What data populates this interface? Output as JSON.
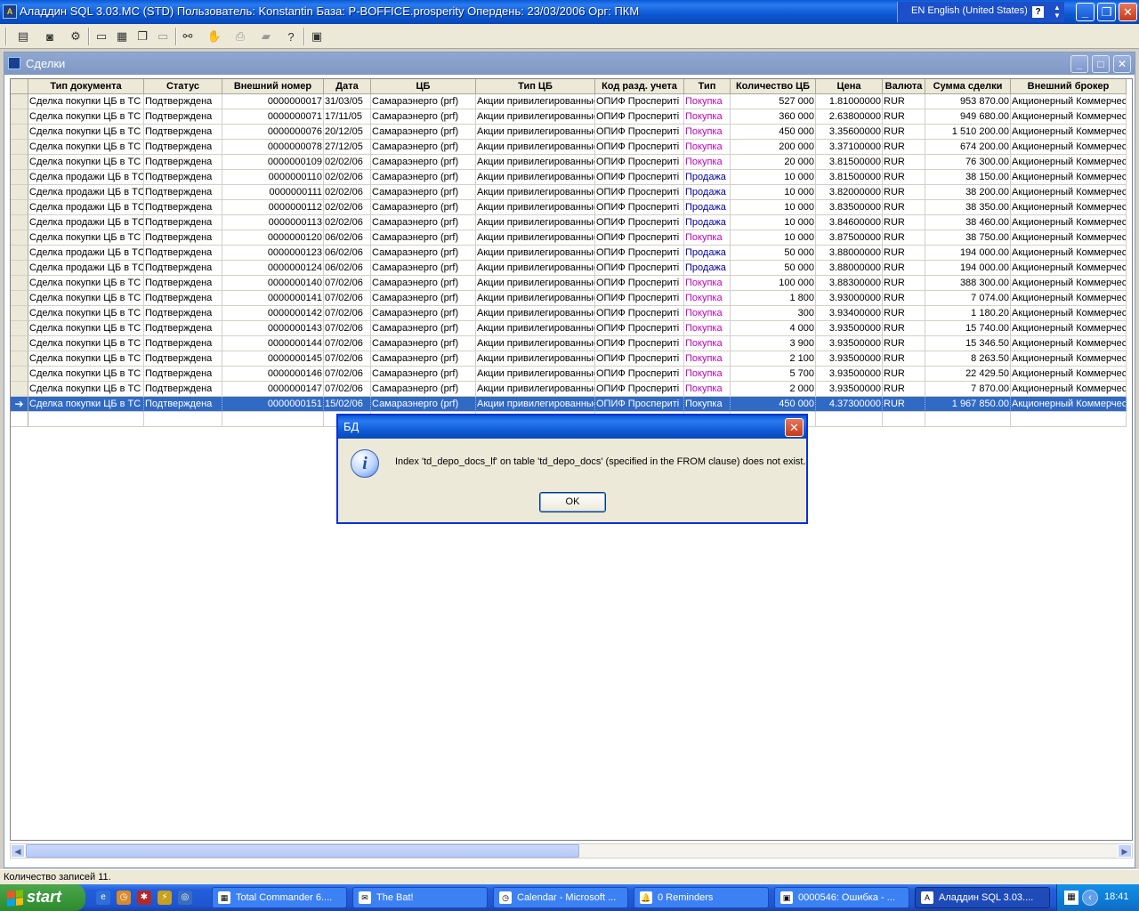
{
  "app": {
    "title": "Аладдин SQL 3.03.MC (STD)  Пользователь: Konstantin База: P-BOFFICE.prosperity Опердень: 23/03/2006 Орг: ПКМ",
    "language": "EN English (United States)",
    "help_label": "?"
  },
  "toolbar": {
    "icons": [
      "list-icon",
      "database-icon",
      "tools-icon",
      "window-icon",
      "tile-icon",
      "cascade-icon",
      "window-disabled-icon",
      "binoculars-icon",
      "hand-disabled-icon",
      "print-icon",
      "export-icon",
      "help-icon",
      "exit-icon"
    ]
  },
  "window": {
    "title": "Сделки"
  },
  "grid": {
    "columns": [
      "Тип документа",
      "Статус",
      "Внешний номер",
      "Дата",
      "ЦБ",
      "Тип ЦБ",
      "Код разд. учета",
      "Тип",
      "Количество ЦБ",
      "Цена",
      "Валюта",
      "Сумма сделки",
      "Внешний брокер"
    ],
    "rows": [
      [
        "Сделка покупки ЦБ в ТС",
        "Подтверждена",
        "0000000017",
        "31/03/05",
        "Самараэнерго (prf)",
        "Акции привилегированные",
        "ОПИФ Проспериті",
        "Покупка",
        "527 000",
        "1.81000000",
        "RUR",
        "953 870.00",
        "Акционерный Коммерческ"
      ],
      [
        "Сделка покупки ЦБ в ТС",
        "Подтверждена",
        "0000000071",
        "17/11/05",
        "Самараэнерго (prf)",
        "Акции привилегированные",
        "ОПИФ Проспериті",
        "Покупка",
        "360 000",
        "2.63800000",
        "RUR",
        "949 680.00",
        "Акционерный Коммерческ"
      ],
      [
        "Сделка покупки ЦБ в ТС",
        "Подтверждена",
        "0000000076",
        "20/12/05",
        "Самараэнерго (prf)",
        "Акции привилегированные",
        "ОПИФ Проспериті",
        "Покупка",
        "450 000",
        "3.35600000",
        "RUR",
        "1 510 200.00",
        "Акционерный Коммерческ"
      ],
      [
        "Сделка покупки ЦБ в ТС",
        "Подтверждена",
        "0000000078",
        "27/12/05",
        "Самараэнерго (prf)",
        "Акции привилегированные",
        "ОПИФ Проспериті",
        "Покупка",
        "200 000",
        "3.37100000",
        "RUR",
        "674 200.00",
        "Акционерный Коммерческ"
      ],
      [
        "Сделка покупки ЦБ в ТС",
        "Подтверждена",
        "0000000109",
        "02/02/06",
        "Самараэнерго (prf)",
        "Акции привилегированные",
        "ОПИФ Проспериті",
        "Покупка",
        "20 000",
        "3.81500000",
        "RUR",
        "76 300.00",
        "Акционерный Коммерческ"
      ],
      [
        "Сделка продажи ЦБ в ТС",
        "Подтверждена",
        "0000000110",
        "02/02/06",
        "Самараэнерго (prf)",
        "Акции привилегированные",
        "ОПИФ Проспериті",
        "Продажа",
        "10 000",
        "3.81500000",
        "RUR",
        "38 150.00",
        "Акционерный Коммерческ"
      ],
      [
        "Сделка продажи ЦБ в ТС",
        "Подтверждена",
        "0000000111",
        "02/02/06",
        "Самараэнерго (prf)",
        "Акции привилегированные",
        "ОПИФ Проспериті",
        "Продажа",
        "10 000",
        "3.82000000",
        "RUR",
        "38 200.00",
        "Акционерный Коммерческ"
      ],
      [
        "Сделка продажи ЦБ в ТС",
        "Подтверждена",
        "0000000112",
        "02/02/06",
        "Самараэнерго (prf)",
        "Акции привилегированные",
        "ОПИФ Проспериті",
        "Продажа",
        "10 000",
        "3.83500000",
        "RUR",
        "38 350.00",
        "Акционерный Коммерческ"
      ],
      [
        "Сделка продажи ЦБ в ТС",
        "Подтверждена",
        "0000000113",
        "02/02/06",
        "Самараэнерго (prf)",
        "Акции привилегированные",
        "ОПИФ Проспериті",
        "Продажа",
        "10 000",
        "3.84600000",
        "RUR",
        "38 460.00",
        "Акционерный Коммерческ"
      ],
      [
        "Сделка покупки ЦБ в ТС",
        "Подтверждена",
        "0000000120",
        "06/02/06",
        "Самараэнерго (prf)",
        "Акции привилегированные",
        "ОПИФ Проспериті",
        "Покупка",
        "10 000",
        "3.87500000",
        "RUR",
        "38 750.00",
        "Акционерный Коммерческ"
      ],
      [
        "Сделка продажи ЦБ в ТС",
        "Подтверждена",
        "0000000123",
        "06/02/06",
        "Самараэнерго (prf)",
        "Акции привилегированные",
        "ОПИФ Проспериті",
        "Продажа",
        "50 000",
        "3.88000000",
        "RUR",
        "194 000.00",
        "Акционерный Коммерческ"
      ],
      [
        "Сделка продажи ЦБ в ТС",
        "Подтверждена",
        "0000000124",
        "06/02/06",
        "Самараэнерго (prf)",
        "Акции привилегированные",
        "ОПИФ Проспериті",
        "Продажа",
        "50 000",
        "3.88000000",
        "RUR",
        "194 000.00",
        "Акционерный Коммерческ"
      ],
      [
        "Сделка покупки ЦБ в ТС",
        "Подтверждена",
        "0000000140",
        "07/02/06",
        "Самараэнерго (prf)",
        "Акции привилегированные",
        "ОПИФ Проспериті",
        "Покупка",
        "100 000",
        "3.88300000",
        "RUR",
        "388 300.00",
        "Акционерный Коммерческ"
      ],
      [
        "Сделка покупки ЦБ в ТС",
        "Подтверждена",
        "0000000141",
        "07/02/06",
        "Самараэнерго (prf)",
        "Акции привилегированные",
        "ОПИФ Проспериті",
        "Покупка",
        "1 800",
        "3.93000000",
        "RUR",
        "7 074.00",
        "Акционерный Коммерческ"
      ],
      [
        "Сделка покупки ЦБ в ТС",
        "Подтверждена",
        "0000000142",
        "07/02/06",
        "Самараэнерго (prf)",
        "Акции привилегированные",
        "ОПИФ Проспериті",
        "Покупка",
        "300",
        "3.93400000",
        "RUR",
        "1 180.20",
        "Акционерный Коммерческ"
      ],
      [
        "Сделка покупки ЦБ в ТС",
        "Подтверждена",
        "0000000143",
        "07/02/06",
        "Самараэнерго (prf)",
        "Акции привилегированные",
        "ОПИФ Проспериті",
        "Покупка",
        "4 000",
        "3.93500000",
        "RUR",
        "15 740.00",
        "Акционерный Коммерческ"
      ],
      [
        "Сделка покупки ЦБ в ТС",
        "Подтверждена",
        "0000000144",
        "07/02/06",
        "Самараэнерго (prf)",
        "Акции привилегированные",
        "ОПИФ Проспериті",
        "Покупка",
        "3 900",
        "3.93500000",
        "RUR",
        "15 346.50",
        "Акционерный Коммерческ"
      ],
      [
        "Сделка покупки ЦБ в ТС",
        "Подтверждена",
        "0000000145",
        "07/02/06",
        "Самараэнерго (prf)",
        "Акции привилегированные",
        "ОПИФ Проспериті",
        "Покупка",
        "2 100",
        "3.93500000",
        "RUR",
        "8 263.50",
        "Акционерный Коммерческ"
      ],
      [
        "Сделка покупки ЦБ в ТС",
        "Подтверждена",
        "0000000146",
        "07/02/06",
        "Самараэнерго (prf)",
        "Акции привилегированные",
        "ОПИФ Проспериті",
        "Покупка",
        "5 700",
        "3.93500000",
        "RUR",
        "22 429.50",
        "Акционерный Коммерческ"
      ],
      [
        "Сделка покупки ЦБ в ТС",
        "Подтверждена",
        "0000000147",
        "07/02/06",
        "Самараэнерго (prf)",
        "Акции привилегированные",
        "ОПИФ Проспериті",
        "Покупка",
        "2 000",
        "3.93500000",
        "RUR",
        "7 870.00",
        "Акционерный Коммерческ"
      ],
      [
        "Сделка покупки ЦБ в ТС",
        "Подтверждена",
        "0000000151",
        "15/02/06",
        "Самараэнерго (prf)",
        "Акции привилегированные",
        "ОПИФ Проспериті",
        "Покупка",
        "450 000",
        "4.37300000",
        "RUR",
        "1 967 850.00",
        "Акционерный Коммерческ"
      ]
    ],
    "selected_row": 20,
    "current_row_marker": "➔",
    "colors": {
      "buy": "#c000c0",
      "sell": "#0000a0",
      "selection": "#316ac5"
    }
  },
  "status_bar": {
    "text": "Количество записей 11."
  },
  "dialog": {
    "title": "БД",
    "message": "Index 'td_depo_docs_lf' on table 'td_depo_docs' (specified in the FROM clause) does not exist.",
    "ok_label": "OK",
    "icon": "info-icon"
  },
  "taskbar": {
    "start_label": "start",
    "tasks": [
      {
        "label": "Total Commander 6....",
        "icon": "total-commander-icon"
      },
      {
        "label": "The Bat!",
        "icon": "the-bat-icon"
      },
      {
        "label": "Calendar - Microsoft ...",
        "icon": "calendar-icon"
      },
      {
        "label": "0 Reminders",
        "icon": "reminder-icon"
      },
      {
        "label": "0000546: Ошибка - ...",
        "icon": "browser-icon"
      },
      {
        "label": "Аладдин SQL 3.03....",
        "icon": "aladdin-icon"
      }
    ],
    "clock": "18:41"
  }
}
